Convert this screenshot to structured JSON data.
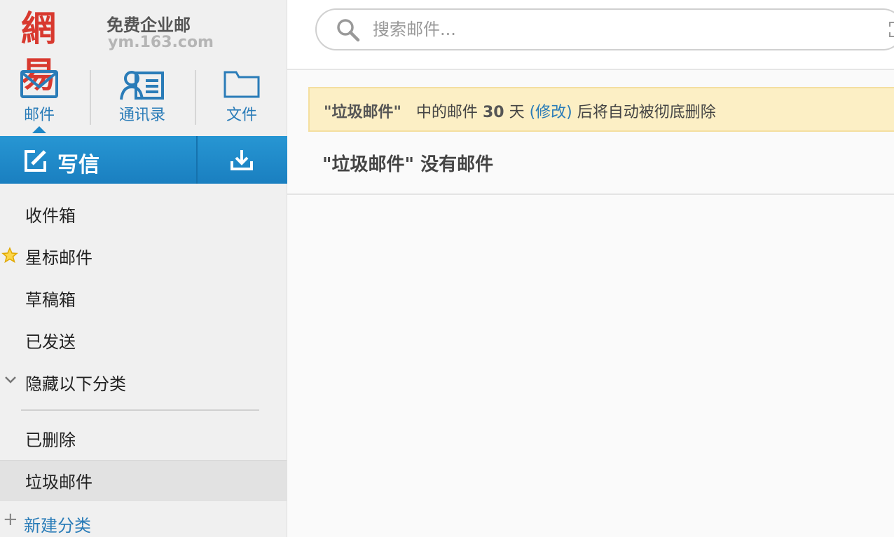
{
  "brand": {
    "logo_text": "網易",
    "product": "免费企业邮",
    "domain": "ym.163.com",
    "color": "#d8392f"
  },
  "nav": {
    "mail_label": "邮件",
    "contacts_label": "通讯录",
    "files_label": "文件",
    "accent_color": "#2a7cb8"
  },
  "compose": {
    "write_label": "写信",
    "bar_color": "#1f87c6"
  },
  "folders": {
    "inbox": "收件箱",
    "starred": "星标邮件",
    "drafts": "草稿箱",
    "sent": "已发送",
    "hide_below": "隐藏以下分类",
    "deleted": "已删除",
    "spam": "垃圾邮件",
    "new_folder": "新建分类",
    "selected": "垃圾邮件"
  },
  "search": {
    "placeholder": "搜索邮件..."
  },
  "notice": {
    "folder": "\"垃圾邮件\"",
    "middle": "中的邮件",
    "days": "30",
    "unit": "天",
    "modify_link": "(修改)",
    "tail": "后将自动被彻底删除"
  },
  "content": {
    "empty_message": "\"垃圾邮件\" 没有邮件"
  }
}
